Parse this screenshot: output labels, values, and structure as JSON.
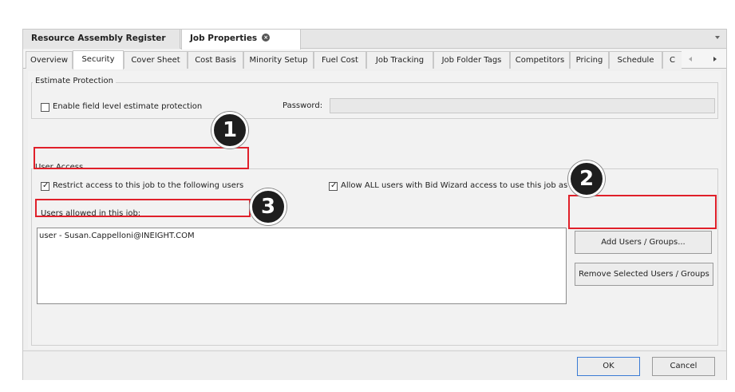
{
  "doc_tabs": [
    {
      "label": "Resource Assembly Register"
    },
    {
      "label": "Job Properties"
    }
  ],
  "property_tabs": [
    {
      "label": "Overview"
    },
    {
      "label": "Security"
    },
    {
      "label": "Cover Sheet"
    },
    {
      "label": "Cost Basis"
    },
    {
      "label": "Minority Setup"
    },
    {
      "label": "Fuel Cost"
    },
    {
      "label": "Job Tracking"
    },
    {
      "label": "Job Folder Tags"
    },
    {
      "label": "Competitors"
    },
    {
      "label": "Pricing"
    },
    {
      "label": "Schedule"
    },
    {
      "label": "C"
    }
  ],
  "active_property_tab": "Security",
  "estimate_protection": {
    "title": "Estimate Protection",
    "enable_label": "Enable field level estimate protection",
    "enable_checked": false,
    "password_label": "Password:",
    "password_value": ""
  },
  "user_access": {
    "title": "User Access",
    "restrict_label": "Restrict access to this job to the following users",
    "restrict_checked": true,
    "allow_label": "Allow ALL users with Bid Wizard access to use this job as a source",
    "allow_checked": true,
    "users_label": "Users allowed in this job:",
    "users": [
      "user - Susan.Cappelloni@INEIGHT.COM"
    ],
    "add_button": "Add Users / Groups...",
    "remove_button": "Remove Selected Users / Groups"
  },
  "footer": {
    "ok": "OK",
    "cancel": "Cancel"
  },
  "callouts": [
    "1",
    "2",
    "3"
  ],
  "colors": {
    "highlight": "#e0202a",
    "badge": "#1e1e1e"
  }
}
